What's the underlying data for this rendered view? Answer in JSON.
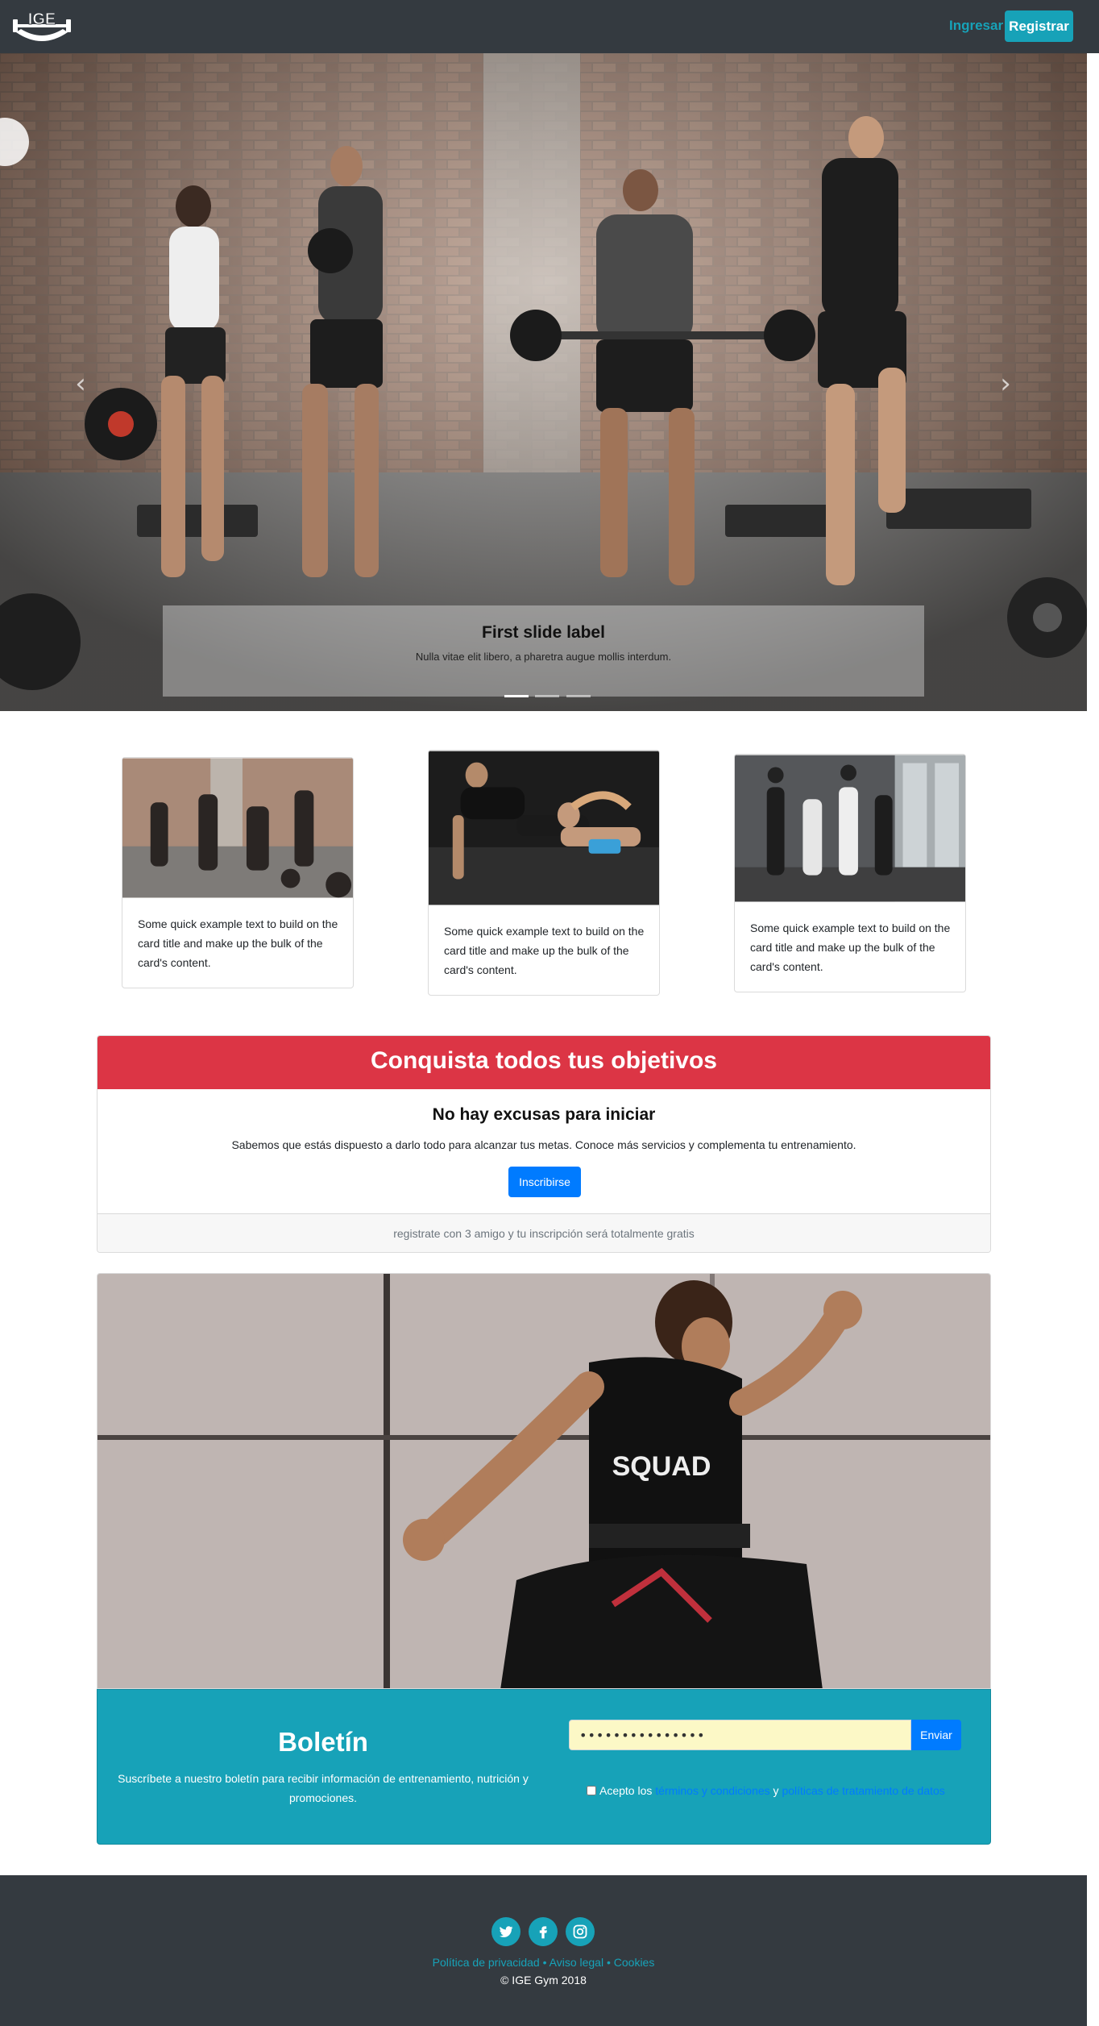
{
  "navbar": {
    "logo_text": "IGE",
    "login_label": "Ingresar",
    "register_label": "Registrar"
  },
  "carousel": {
    "prev_icon": "chevron-left-icon",
    "next_icon": "chevron-right-icon",
    "caption_title": "First slide label",
    "caption_text": "Nulla vitae elit libero, a pharetra augue mollis interdum.",
    "slide_count": 3,
    "active_slide": 1
  },
  "cards": [
    {
      "text": "Some quick example text to build on the card title and make up the bulk of the card's content."
    },
    {
      "text": "Some quick example text to build on the card title and make up the bulk of the card's content."
    },
    {
      "text": "Some quick example text to build on the card title and make up the bulk of the card's content."
    }
  ],
  "cta": {
    "header": "Conquista todos tus objetivos",
    "subtitle": "No hay excusas para iniciar",
    "text": "Sabemos que estás dispuesto a darlo todo para alcanzar tus metas. Conoce más servicios y complementa tu entrenamiento.",
    "button_label": "Inscribirse",
    "footer_text": "registrate con 3 amigo y tu inscripción será totalmente gratis"
  },
  "newsletter": {
    "title": "Boletín",
    "description": "Suscríbete a nuestro boletín para recibir información de entrenamiento, nutrición y promociones.",
    "input_value": "•••••••••••••••",
    "send_label": "Enviar",
    "accept_prefix": "Acepto los ",
    "terms_link": "términos y condiciones",
    "and_text": " y ",
    "privacy_link": "políticas de tratamiento de datos"
  },
  "footer": {
    "social_icons": [
      "twitter-icon",
      "facebook-icon",
      "instagram-icon"
    ],
    "link_privacy": "Política de privacidad",
    "separator": " • ",
    "link_legal": "Aviso legal",
    "link_cookies": "Cookies",
    "copyright": "© IGE Gym 2018"
  },
  "colors": {
    "navbar": "#343a40",
    "accent": "#17a2b8",
    "primary": "#007bff",
    "danger": "#dc3545"
  }
}
